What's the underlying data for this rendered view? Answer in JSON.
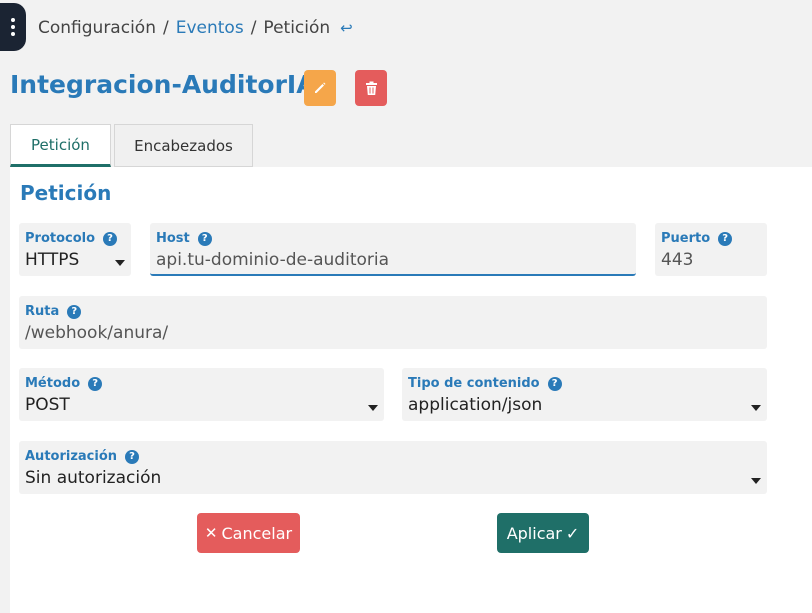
{
  "breadcrumb": {
    "items": [
      "Configuración",
      "Eventos",
      "Petición"
    ],
    "separator": "/"
  },
  "title": "Integracion-AuditorIA",
  "tabs": [
    {
      "label": "Petición",
      "active": true
    },
    {
      "label": "Encabezados",
      "active": false
    }
  ],
  "section_title": "Petición",
  "fields": {
    "protocolo": {
      "label": "Protocolo",
      "value": "HTTPS"
    },
    "host": {
      "label": "Host",
      "value": "api.tu-dominio-de-auditoria"
    },
    "puerto": {
      "label": "Puerto",
      "value": "443"
    },
    "ruta": {
      "label": "Ruta",
      "value": "/webhook/anura/"
    },
    "metodo": {
      "label": "Método",
      "value": "POST"
    },
    "tipo_contenido": {
      "label": "Tipo de contenido",
      "value": "application/json"
    },
    "autorizacion": {
      "label": "Autorización",
      "value": "Sin autorización"
    }
  },
  "help_glyph": "?",
  "buttons": {
    "cancel": {
      "icon": "✕",
      "label": "Cancelar"
    },
    "apply": {
      "label": "Aplicar",
      "icon": "✓"
    }
  },
  "colors": {
    "accent_blue": "#2a7ab8",
    "teal": "#1f6f68",
    "danger": "#e45c5c",
    "warning": "#f5a64a"
  },
  "icons": [
    "kebab-menu-icon",
    "back-arrow-icon",
    "pencil-icon",
    "trash-icon",
    "help-icon",
    "caret-down-icon",
    "close-icon",
    "check-icon"
  ]
}
